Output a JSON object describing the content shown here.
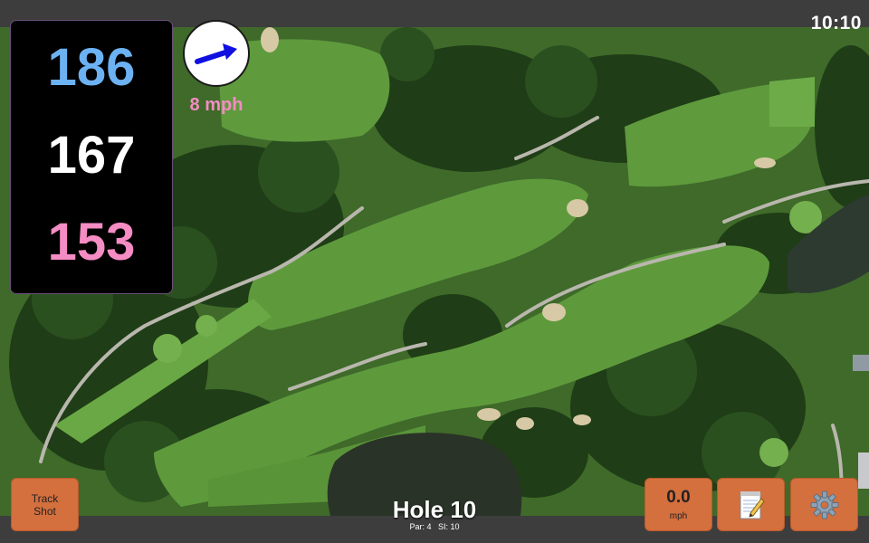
{
  "status": {
    "clock": "10:10"
  },
  "distances": {
    "back": "186",
    "middle": "167",
    "front": "153"
  },
  "wind": {
    "speed_label": "8 mph",
    "arrow_icon": "wind-arrow-icon",
    "arrow_color": "#1010e0"
  },
  "hole": {
    "title": "Hole 10",
    "par_label": "Par: 4",
    "si_label": "SI: 10"
  },
  "buttons": {
    "track_shot_line1": "Track",
    "track_shot_line2": "Shot",
    "speed_value": "0.0",
    "speed_unit": "mph",
    "notes_icon": "notepad-icon",
    "settings_icon": "gear-icon"
  },
  "colors": {
    "back_distance": "#6cb2f2",
    "middle_distance": "#ffffff",
    "front_distance": "#f58cc3",
    "button_accent": "#d46f3e"
  }
}
